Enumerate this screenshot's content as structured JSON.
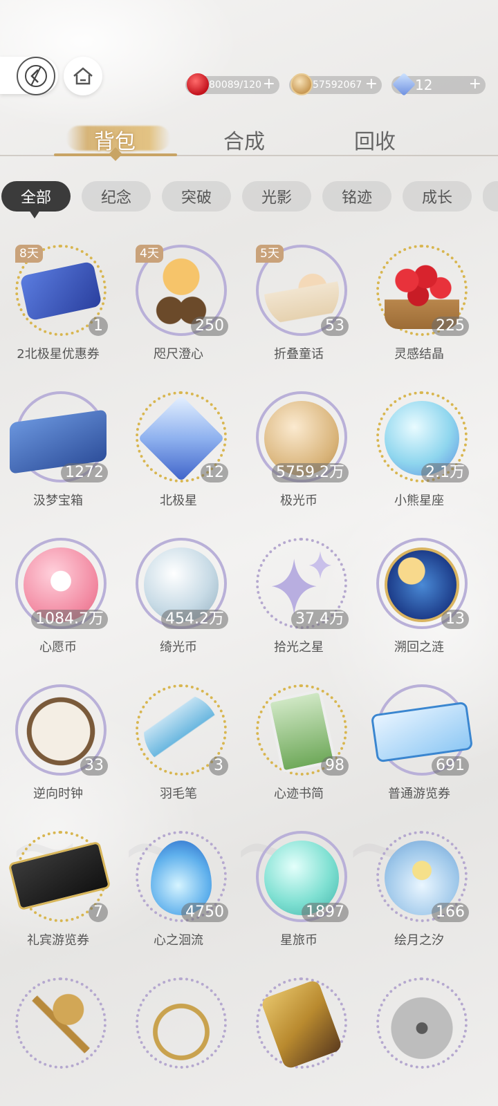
{
  "currencies": {
    "apple": {
      "value": "80089/120",
      "icon": "apple-icon"
    },
    "coin": {
      "value": "57592067",
      "icon": "coin-icon"
    },
    "gem": {
      "value": "12",
      "icon": "crystal-icon"
    }
  },
  "main_tabs": [
    {
      "label": "背包"
    },
    {
      "label": "合成"
    },
    {
      "label": "回收"
    }
  ],
  "filters": [
    {
      "label": "全部"
    },
    {
      "label": "纪念"
    },
    {
      "label": "突破"
    },
    {
      "label": "光影"
    },
    {
      "label": "铭迹"
    },
    {
      "label": "成长"
    }
  ],
  "items": [
    {
      "name": "2北极星优惠券",
      "count": "1",
      "days": "8天"
    },
    {
      "name": "咫尺澄心",
      "count": "250",
      "days": "4天"
    },
    {
      "name": "折叠童话",
      "count": "53",
      "days": "5天"
    },
    {
      "name": "灵感结晶",
      "count": "225"
    },
    {
      "name": "汲梦宝箱",
      "count": "1272"
    },
    {
      "name": "北极星",
      "count": "12"
    },
    {
      "name": "极光币",
      "count": "5759.2万"
    },
    {
      "name": "小熊星座",
      "count": "2.1万"
    },
    {
      "name": "心愿币",
      "count": "1084.7万"
    },
    {
      "name": "绮光币",
      "count": "454.2万"
    },
    {
      "name": "拾光之星",
      "count": "37.4万"
    },
    {
      "name": "溯回之涟",
      "count": "13"
    },
    {
      "name": "逆向时钟",
      "count": "33"
    },
    {
      "name": "羽毛笔",
      "count": "3"
    },
    {
      "name": "心迹书简",
      "count": "98"
    },
    {
      "name": "普通游览券",
      "count": "691"
    },
    {
      "name": "礼宾游览券",
      "count": "7"
    },
    {
      "name": "心之洄流",
      "count": "4750"
    },
    {
      "name": "星旅币",
      "count": "1897"
    },
    {
      "name": "绘月之汐",
      "count": "166"
    }
  ]
}
